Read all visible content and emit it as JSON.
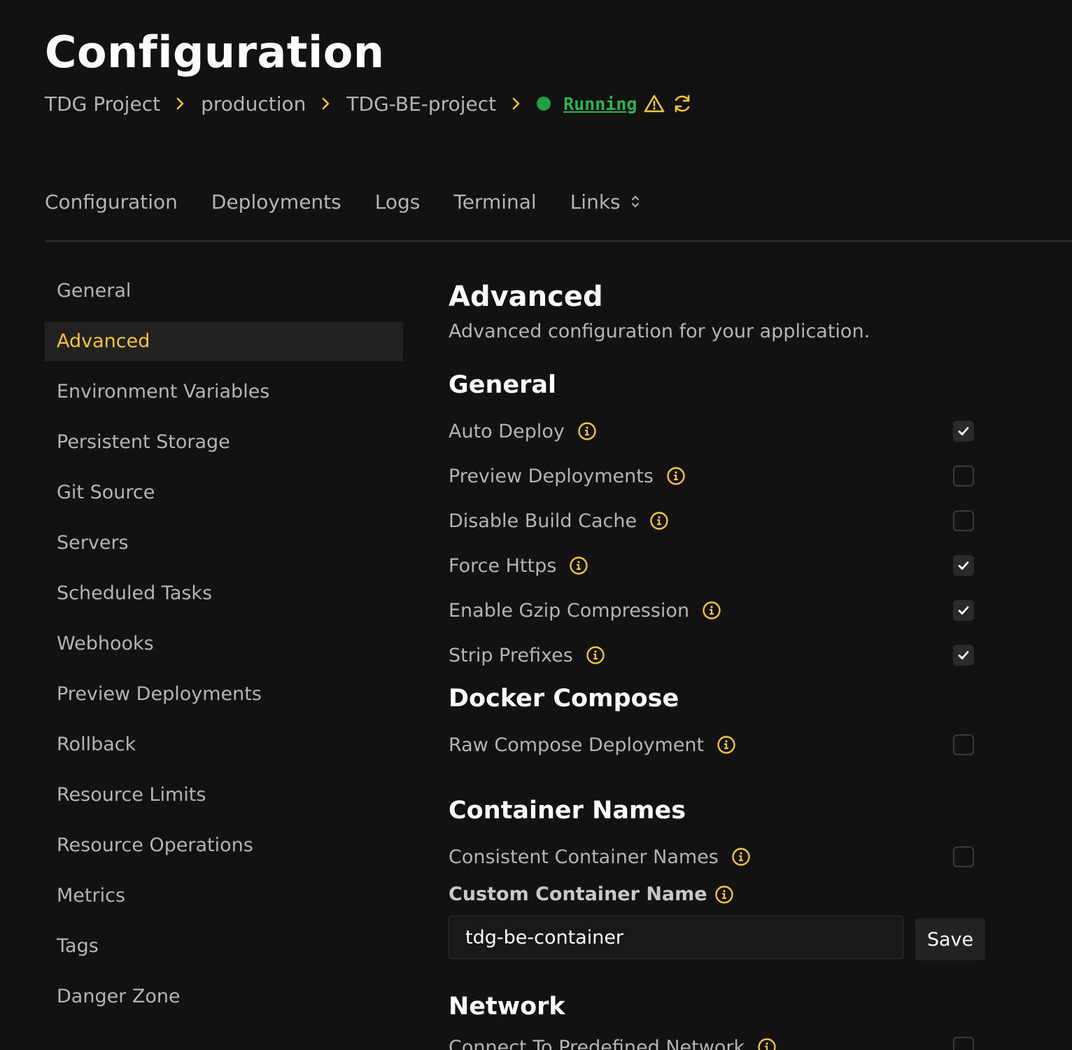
{
  "page": {
    "title": "Configuration"
  },
  "breadcrumb": {
    "items": [
      "TDG Project",
      "production",
      "TDG-BE-project"
    ],
    "status": "Running"
  },
  "tabs": [
    "Configuration",
    "Deployments",
    "Logs",
    "Terminal",
    "Links"
  ],
  "sidebar": {
    "items": [
      "General",
      "Advanced",
      "Environment Variables",
      "Persistent Storage",
      "Git Source",
      "Servers",
      "Scheduled Tasks",
      "Webhooks",
      "Preview Deployments",
      "Rollback",
      "Resource Limits",
      "Resource Operations",
      "Metrics",
      "Tags",
      "Danger Zone"
    ],
    "active": "Advanced"
  },
  "main": {
    "title": "Advanced",
    "subtitle": "Advanced configuration for your application.",
    "general": {
      "heading": "General",
      "options": [
        {
          "label": "Auto Deploy",
          "checked": true
        },
        {
          "label": "Preview Deployments",
          "checked": false
        },
        {
          "label": "Disable Build Cache",
          "checked": false
        },
        {
          "label": "Force Https",
          "checked": true
        },
        {
          "label": "Enable Gzip Compression",
          "checked": true
        },
        {
          "label": "Strip Prefixes",
          "checked": true
        }
      ]
    },
    "docker_compose": {
      "heading": "Docker Compose",
      "options": [
        {
          "label": "Raw Compose Deployment",
          "checked": false
        }
      ]
    },
    "container_names": {
      "heading": "Container Names",
      "options": [
        {
          "label": "Consistent Container Names",
          "checked": false
        }
      ],
      "custom_label": "Custom Container Name",
      "custom_value": "tdg-be-container",
      "save_label": "Save"
    },
    "network": {
      "heading": "Network",
      "options": [
        {
          "label": "Connect To Predefined Network",
          "checked": false
        }
      ]
    }
  },
  "colors": {
    "background": "#121212",
    "accent": "#f2c245",
    "status_green": "#21a043"
  }
}
